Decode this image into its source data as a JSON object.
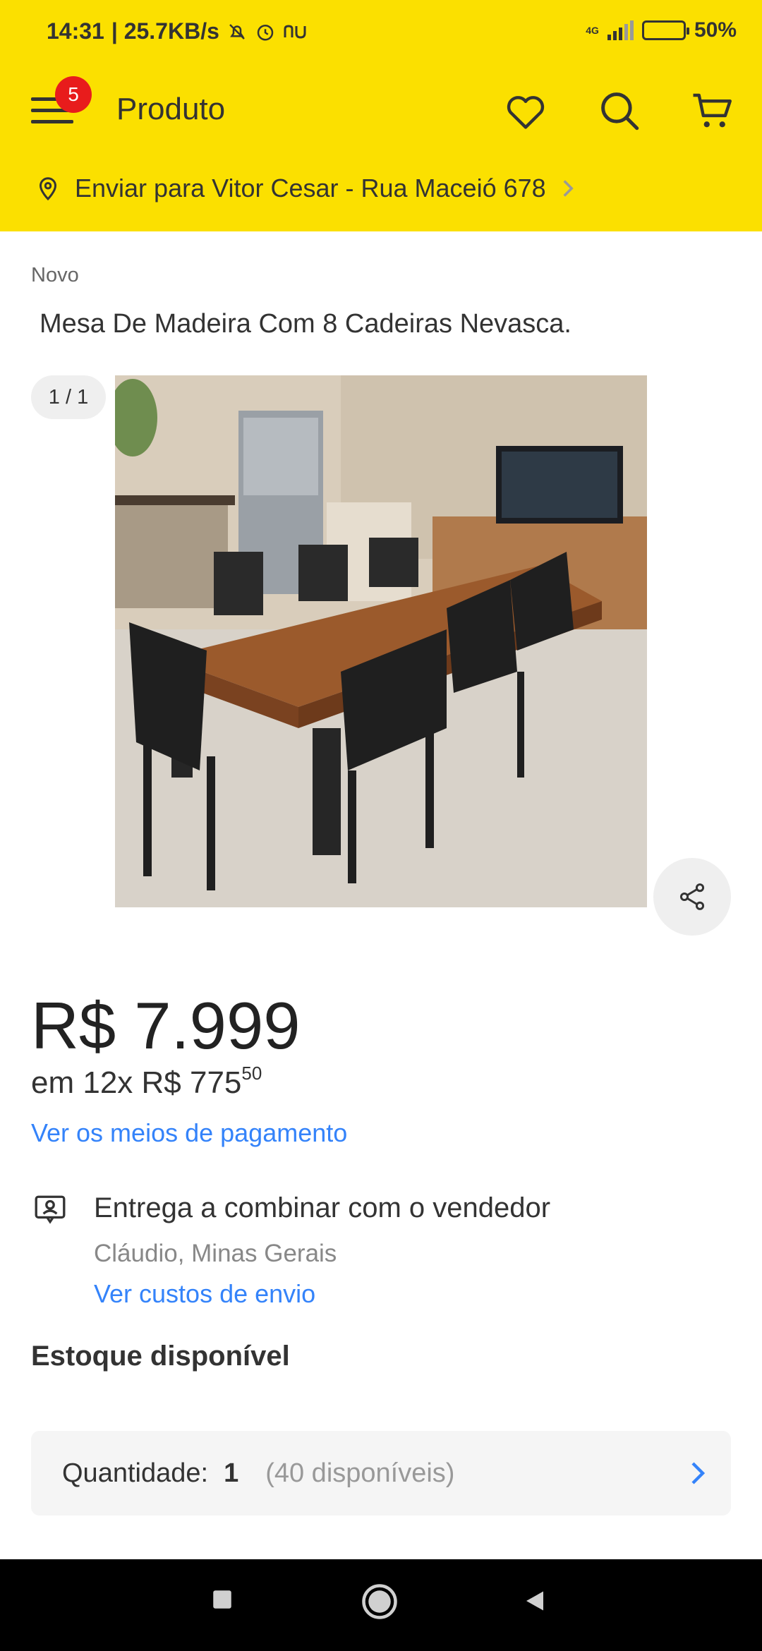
{
  "status_bar": {
    "time": "14:31",
    "speed": "| 25.7KB/s",
    "network": "4G",
    "battery": "50%",
    "battery_level": 0.5
  },
  "header": {
    "title": "Produto",
    "notification_count": "5",
    "ship_to": "Enviar para Vitor Cesar - Rua Maceió 678"
  },
  "product": {
    "condition": "Novo",
    "title": "Mesa De Madeira Com 8 Cadeiras Nevasca.",
    "image_counter": "1 / 1"
  },
  "pricing": {
    "price": "R$ 7.999",
    "installments_prefix": "em 12x R$ 775",
    "installments_cents": "50",
    "payment_link": "Ver os meios de pagamento"
  },
  "delivery": {
    "title": "Entrega a combinar com o vendedor",
    "location": "Cláudio, Minas Gerais",
    "shipping_link": "Ver custos de envio"
  },
  "stock": {
    "heading": "Estoque disponível",
    "quantity_label": "Quantidade:",
    "quantity_value": "1",
    "available": "(40 disponíveis)"
  },
  "colors": {
    "brand_yellow": "#fbe000",
    "link_blue": "#3483fa",
    "badge_red": "#e81c1c"
  }
}
